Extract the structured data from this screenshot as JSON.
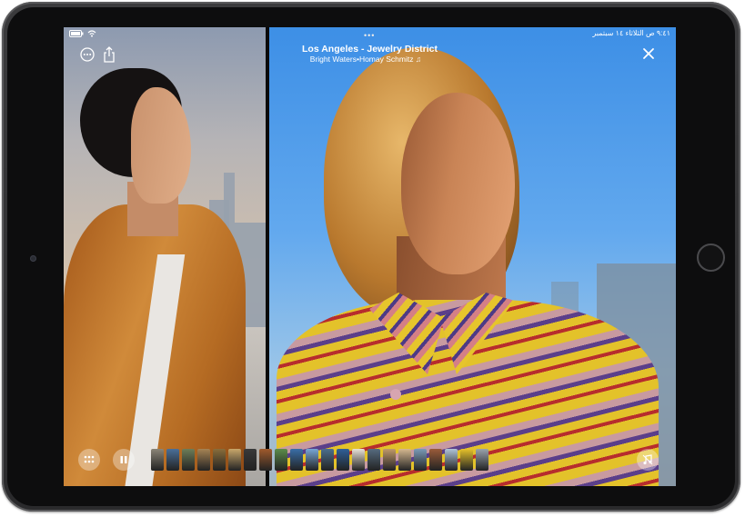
{
  "status_bar": {
    "datetime": "٩:٤١ ص الثلاثاء ١٤ سبتمبر"
  },
  "multitasking_dots": "•••",
  "now_playing": {
    "title": "Los Angeles - Jewelry District",
    "subtitle": "Bright Waters•Homay Schmitz ♫"
  },
  "icons": {
    "more": "ellipsis-circle-icon",
    "share": "share-icon",
    "close": "close-icon",
    "grid": "grid-icon",
    "pause": "pause-icon",
    "music": "music-note-icon",
    "wifi": "wifi-icon",
    "battery": "battery-icon"
  },
  "filmstrip": {
    "thumbnail_colors": [
      "#8b8577",
      "#4a6f9a",
      "#6d7d58",
      "#a68354",
      "#8a6d3b",
      "#c8a76a",
      "#3a3a3a",
      "#a05a2c",
      "#5c8d4b",
      "#3a6ea8",
      "#77a7d6",
      "#4d6f8d",
      "#2f5f9a",
      "#e8e2d8",
      "#566b7f",
      "#c09a6a",
      "#d5b890",
      "#7a9bb8",
      "#9b5b3a",
      "#b0c4d8",
      "#e6c22a",
      "#9aa3ad"
    ]
  }
}
